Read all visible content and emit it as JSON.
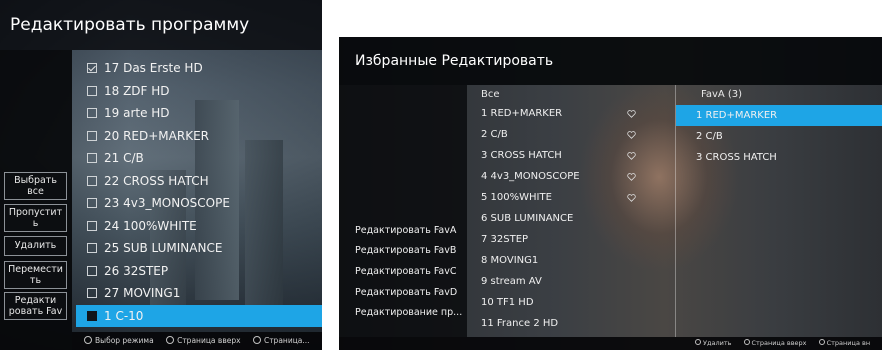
{
  "program_edit": {
    "title": "Редактировать программу",
    "side_buttons": [
      {
        "label": "Выбрать все"
      },
      {
        "label": "Пропустит ь"
      },
      {
        "label": "Удалить"
      },
      {
        "label": "Перемести ть"
      },
      {
        "label": "Редакти ровать Fav"
      }
    ],
    "channels": [
      {
        "label": "17 Das Erste HD",
        "checked": true
      },
      {
        "label": "18 ZDF HD",
        "checked": false
      },
      {
        "label": "19 arte HD",
        "checked": false
      },
      {
        "label": "20 RED+MARKER",
        "checked": false
      },
      {
        "label": "21 C/B",
        "checked": false
      },
      {
        "label": "22 CROSS HATCH",
        "checked": false
      },
      {
        "label": "23 4v3_MONOSCOPE",
        "checked": false
      },
      {
        "label": "24 100%WHITE",
        "checked": false
      },
      {
        "label": "25 SUB LUMINANCE",
        "checked": false
      },
      {
        "label": "26 32STEP",
        "checked": false
      },
      {
        "label": "27 MOVING1",
        "checked": false
      },
      {
        "label": "1 C-10",
        "checked": false,
        "selected": true
      }
    ],
    "footer": {
      "mode_select": "Выбор режима",
      "page_up": "Страница вверх",
      "page_truncated": "Страница..."
    }
  },
  "favorites_edit": {
    "title": "Избранные Редактировать",
    "all_header": "Все",
    "fav_header": "FavA (3)",
    "side_items": [
      {
        "label": "Редактировать FavA"
      },
      {
        "label": "Редактировать FavB"
      },
      {
        "label": "Редактировать FavC"
      },
      {
        "label": "Редактировать FavD"
      },
      {
        "label": "Редактирование пр..."
      }
    ],
    "all_channels": [
      {
        "label": "1 RED+MARKER",
        "fav": true
      },
      {
        "label": "2 C/B",
        "fav": true
      },
      {
        "label": "3 CROSS HATCH",
        "fav": true
      },
      {
        "label": "4 4v3_MONOSCOPE",
        "fav": true
      },
      {
        "label": "5 100%WHITE",
        "fav": true
      },
      {
        "label": "6 SUB LUMINANCE",
        "fav": false
      },
      {
        "label": "7 32STEP",
        "fav": false
      },
      {
        "label": "8 MOVING1",
        "fav": false
      },
      {
        "label": "9 stream AV",
        "fav": false
      },
      {
        "label": "10 TF1 HD",
        "fav": false
      },
      {
        "label": "11 France 2 HD",
        "fav": false
      }
    ],
    "fav_channels": [
      {
        "label": "1 RED+MARKER",
        "selected": true
      },
      {
        "label": "2 C/B",
        "selected": false
      },
      {
        "label": "3 CROSS HATCH",
        "selected": false
      }
    ],
    "footer": {
      "delete": "Удалить",
      "page_up": "Страница вверх",
      "page_down_truncated": "Страница вн"
    }
  }
}
